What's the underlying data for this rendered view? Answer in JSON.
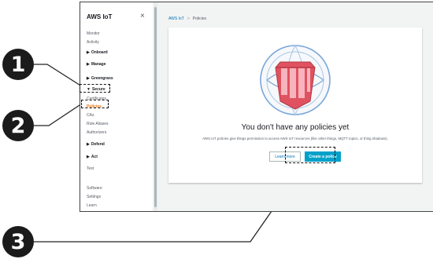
{
  "callouts": [
    "1",
    "2",
    "3"
  ],
  "sidebar": {
    "title": "AWS IoT",
    "close_icon": "×",
    "items": [
      {
        "label": "Monitor"
      },
      {
        "label": "Activity"
      },
      {
        "label": "Onboard"
      },
      {
        "label": "Manage"
      },
      {
        "label": "Greengrass"
      },
      {
        "label": "Secure"
      },
      {
        "label": "Certificates"
      },
      {
        "label": "Policies"
      },
      {
        "label": "CAs"
      },
      {
        "label": "Role Aliases"
      },
      {
        "label": "Authorizers"
      },
      {
        "label": "Defend"
      },
      {
        "label": "Act"
      },
      {
        "label": "Test"
      },
      {
        "label": "Software"
      },
      {
        "label": "Settings"
      },
      {
        "label": "Learn"
      }
    ]
  },
  "breadcrumb": {
    "root": "AWS IoT",
    "separator": ">",
    "current": "Policies"
  },
  "empty_state": {
    "title": "You don't have any policies yet",
    "description": "AWS IoT policies give things permission to access AWS IoT resources (like other things, MQTT topics, or thing shadows).",
    "learn_more_label": "Learn more",
    "create_label": "Create a policy"
  },
  "colors": {
    "accent": "#ec7211",
    "primary_button": "#00a1c9",
    "link": "#0073bb",
    "illustration": "#e05260"
  }
}
